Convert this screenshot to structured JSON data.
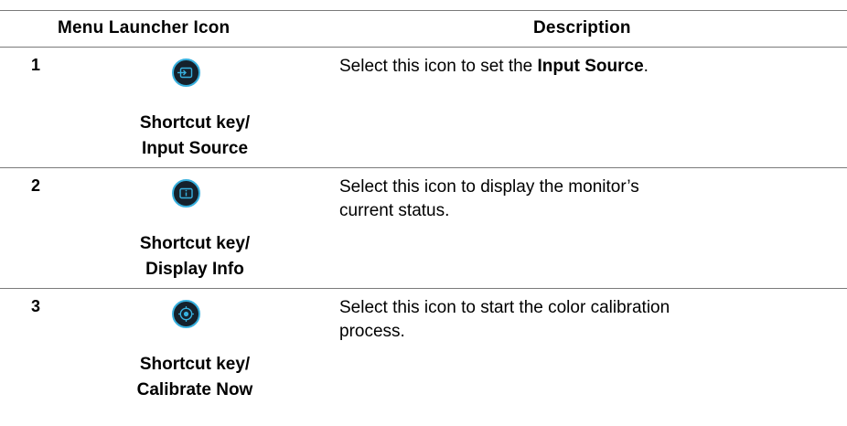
{
  "table": {
    "headers": {
      "icon_column": "Menu Launcher Icon",
      "description_column": "Description"
    },
    "rows": [
      {
        "number": "1",
        "icon": "input-source-icon",
        "caption_line1": "Shortcut key/",
        "caption_line2": "Input Source",
        "desc_prefix": "Select this icon to set the ",
        "desc_bold": "Input Source",
        "desc_suffix": "."
      },
      {
        "number": "2",
        "icon": "display-info-icon",
        "caption_line1": "Shortcut key/",
        "caption_line2": "Display Info",
        "desc_prefix": "Select this icon to display the monitor’s current status.",
        "desc_bold": "",
        "desc_suffix": ""
      },
      {
        "number": "3",
        "icon": "calibrate-now-icon",
        "caption_line1": "Shortcut key/",
        "caption_line2": "Calibrate Now",
        "desc_prefix": "Select this icon to start the color calibration process.",
        "desc_bold": "",
        "desc_suffix": ""
      }
    ]
  },
  "colors": {
    "icon_background": "#15212c",
    "icon_accent": "#38b0de",
    "rule": "#7a7a7a"
  }
}
